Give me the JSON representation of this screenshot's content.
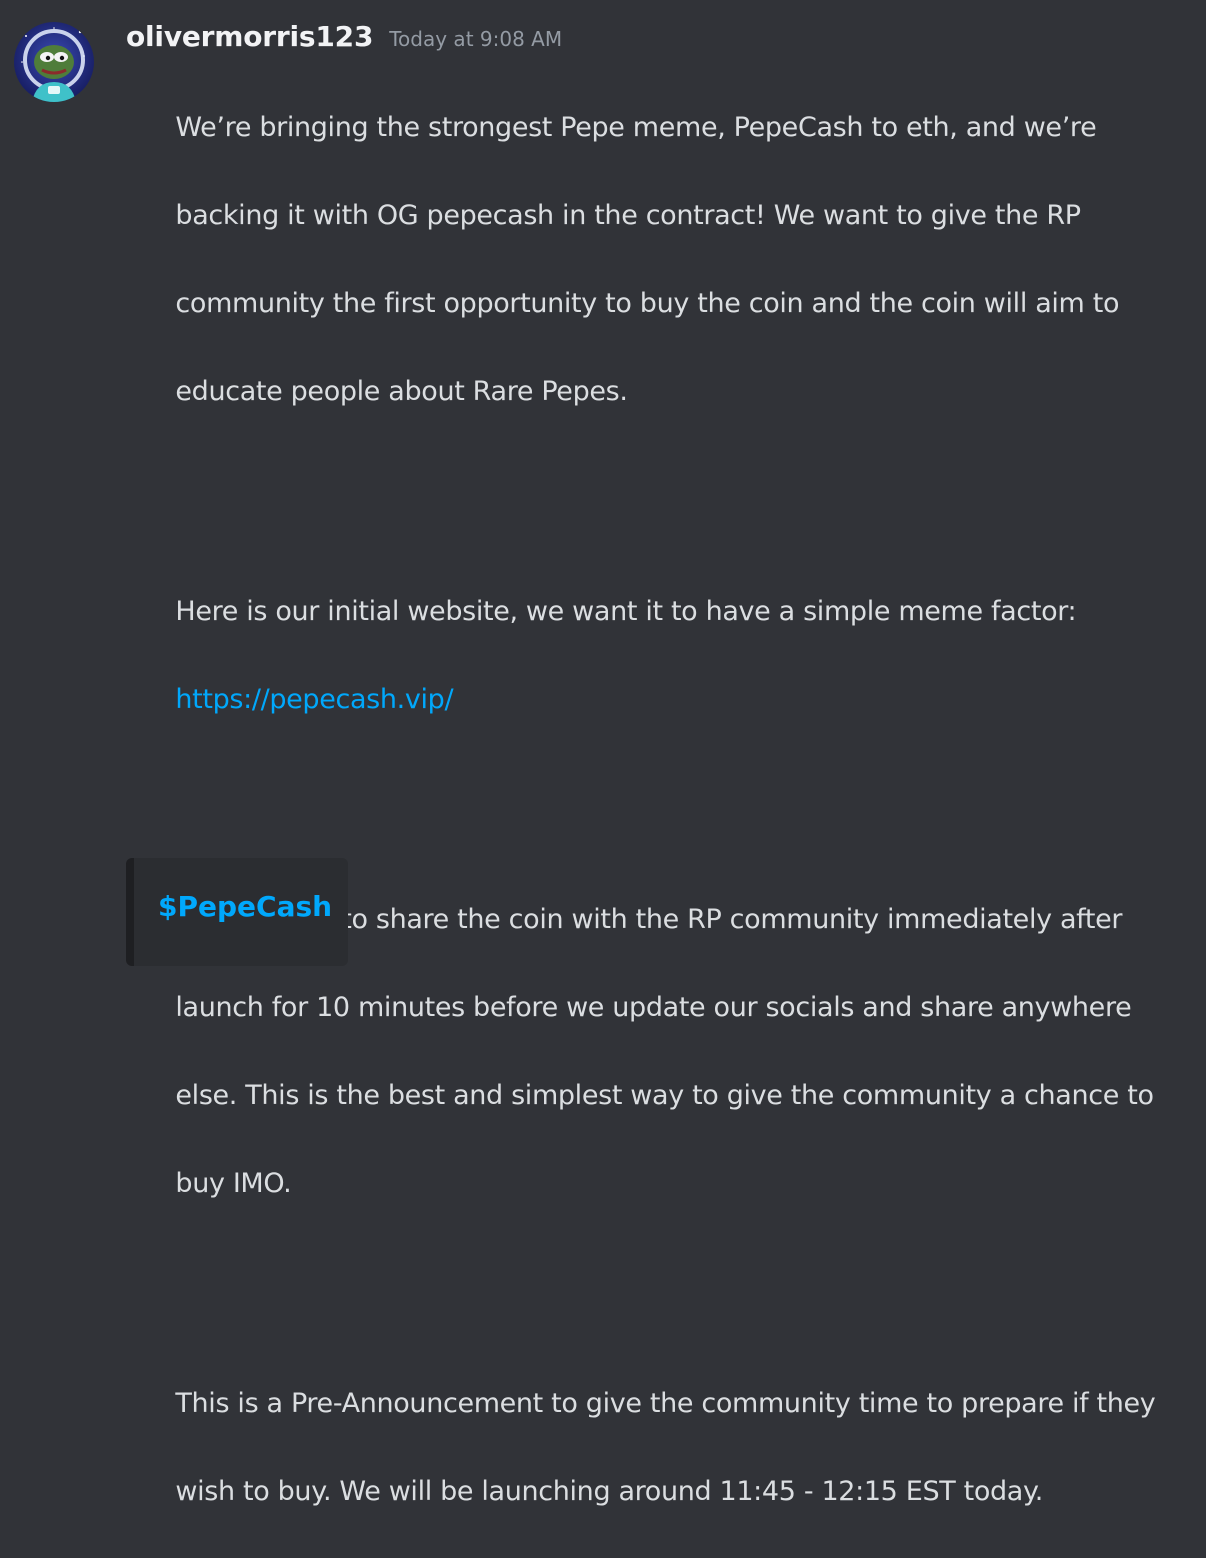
{
  "message": {
    "author": {
      "username": "olivermorris123",
      "avatar_icon": "pepe-avatar-icon"
    },
    "timestamp": "Today at 9:08 AM",
    "paragraphs": [
      {
        "lines": [
          "We’re bringing the strongest Pepe meme, PepeCash to eth, and we’re",
          "backing it with OG pepecash in the contract! We want to give the RP",
          "community the first opportunity to buy the coin and the coin will aim to",
          "educate people about Rare Pepes."
        ]
      },
      {
        "lines": [
          "Here is our initial website, we want it to have a simple meme factor:"
        ],
        "link": "https://pepecash.vip/"
      },
      {
        "lines": [
          "We’re going to share the coin with the RP community immediately after",
          "launch for 10 minutes before we update our socials and share anywhere",
          "else. This is the best and simplest way to give the community a chance to",
          "buy IMO."
        ]
      },
      {
        "lines": [
          "This is a Pre-Announcement to give the community time to prepare if they",
          "wish to buy. We will be launching around 11:45 - 12:15 EST today."
        ]
      }
    ],
    "embed": {
      "title": "$PepeCash"
    }
  },
  "colors": {
    "background": "#313338",
    "text": "#dbdee1",
    "username": "#f2f3f5",
    "timestamp": "#949ba4",
    "link": "#00a8fc",
    "embed_background": "#2b2d31",
    "embed_border": "#1e1f22"
  }
}
